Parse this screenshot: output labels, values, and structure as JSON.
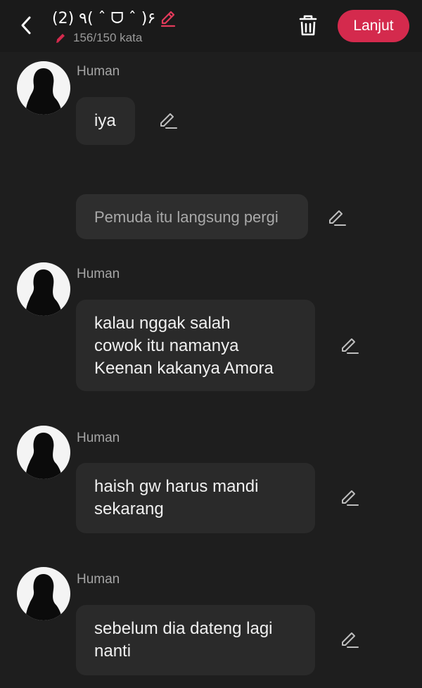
{
  "header": {
    "title": "(2) ٩( ˆ ᗜ ˆ )۶",
    "word_count": "156/150 kata",
    "next_label": "Lanjut",
    "accent_color": "#d42a4d"
  },
  "messages": [
    {
      "sender": "Human",
      "text": "iya"
    },
    {
      "narration": "Pemuda itu langsung pergi"
    },
    {
      "sender": "Human",
      "text": "kalau nggak salah\ncowok itu namanya\nKeenan kakanya Amora"
    },
    {
      "sender": "Human",
      "text": "haish gw harus mandi\nsekarang"
    },
    {
      "sender": "Human",
      "text": "sebelum dia dateng lagi\nnanti"
    }
  ]
}
